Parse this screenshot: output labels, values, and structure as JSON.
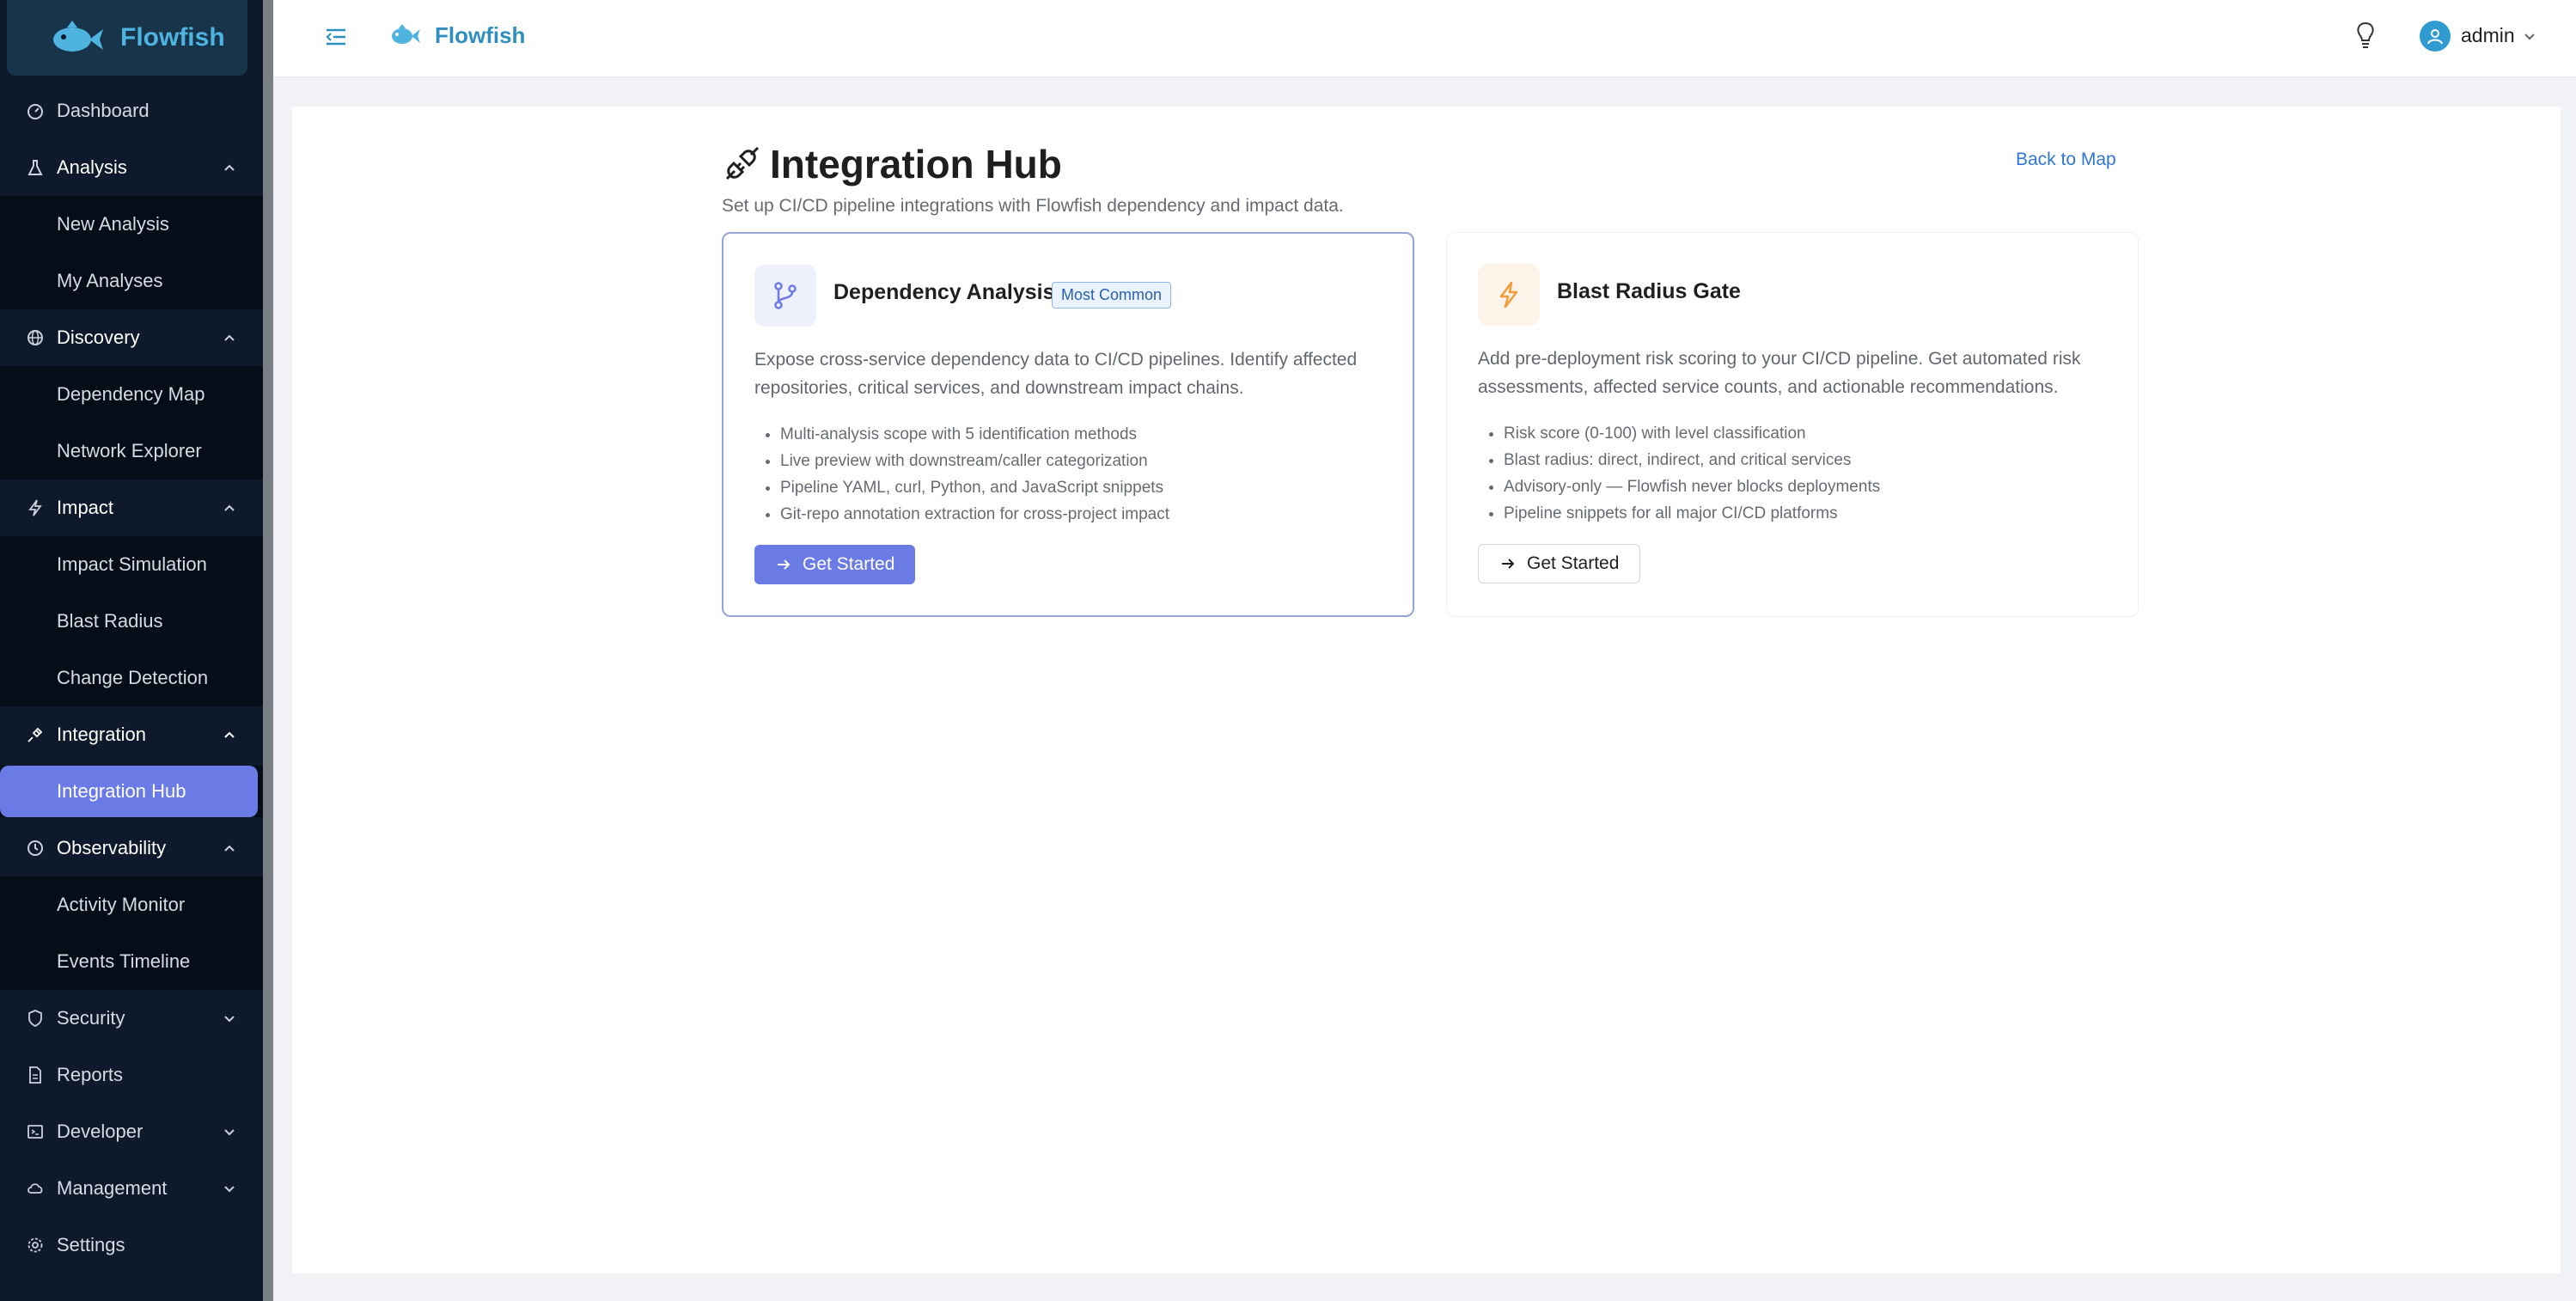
{
  "app": {
    "brand": "Flowfish"
  },
  "header": {
    "brand": "Flowfish",
    "user": "admin"
  },
  "sidebar": {
    "items": [
      {
        "label": "Dashboard"
      },
      {
        "label": "Analysis",
        "children": [
          "New Analysis",
          "My Analyses"
        ]
      },
      {
        "label": "Discovery",
        "children": [
          "Dependency Map",
          "Network Explorer"
        ]
      },
      {
        "label": "Impact",
        "children": [
          "Impact Simulation",
          "Blast Radius",
          "Change Detection"
        ]
      },
      {
        "label": "Integration",
        "children": [
          "Integration Hub"
        ]
      },
      {
        "label": "Observability",
        "children": [
          "Activity Monitor",
          "Events Timeline"
        ]
      },
      {
        "label": "Security"
      },
      {
        "label": "Reports"
      },
      {
        "label": "Developer"
      },
      {
        "label": "Management"
      },
      {
        "label": "Settings"
      }
    ],
    "active": "Integration Hub"
  },
  "page": {
    "title": "Integration Hub",
    "subtitle": "Set up CI/CD pipeline integrations with Flowfish dependency and impact data.",
    "back_link": "Back to Map"
  },
  "cards": [
    {
      "title": "Dependency Analysis",
      "badge": "Most Common",
      "icon": "branch-icon",
      "accent": "#6b7be6",
      "description": "Expose cross-service dependency data to CI/CD pipelines. Identify affected repositories, critical services, and downstream impact chains.",
      "features": [
        "Multi-analysis scope with 5 identification methods",
        "Live preview with downstream/caller categorization",
        "Pipeline YAML, curl, Python, and JavaScript snippets",
        "Git-repo annotation extraction for cross-project impact"
      ],
      "button": "Get Started"
    },
    {
      "title": "Blast Radius Gate",
      "icon": "lightning-icon",
      "accent": "#f29b38",
      "description": "Add pre-deployment risk scoring to your CI/CD pipeline. Get automated risk assessments, affected service counts, and actionable recommendations.",
      "features": [
        "Risk score (0-100) with level classification",
        "Blast radius: direct, indirect, and critical services",
        "Advisory-only — Flowfish never blocks deployments",
        "Pipeline snippets for all major CI/CD platforms"
      ],
      "button": "Get Started"
    }
  ]
}
